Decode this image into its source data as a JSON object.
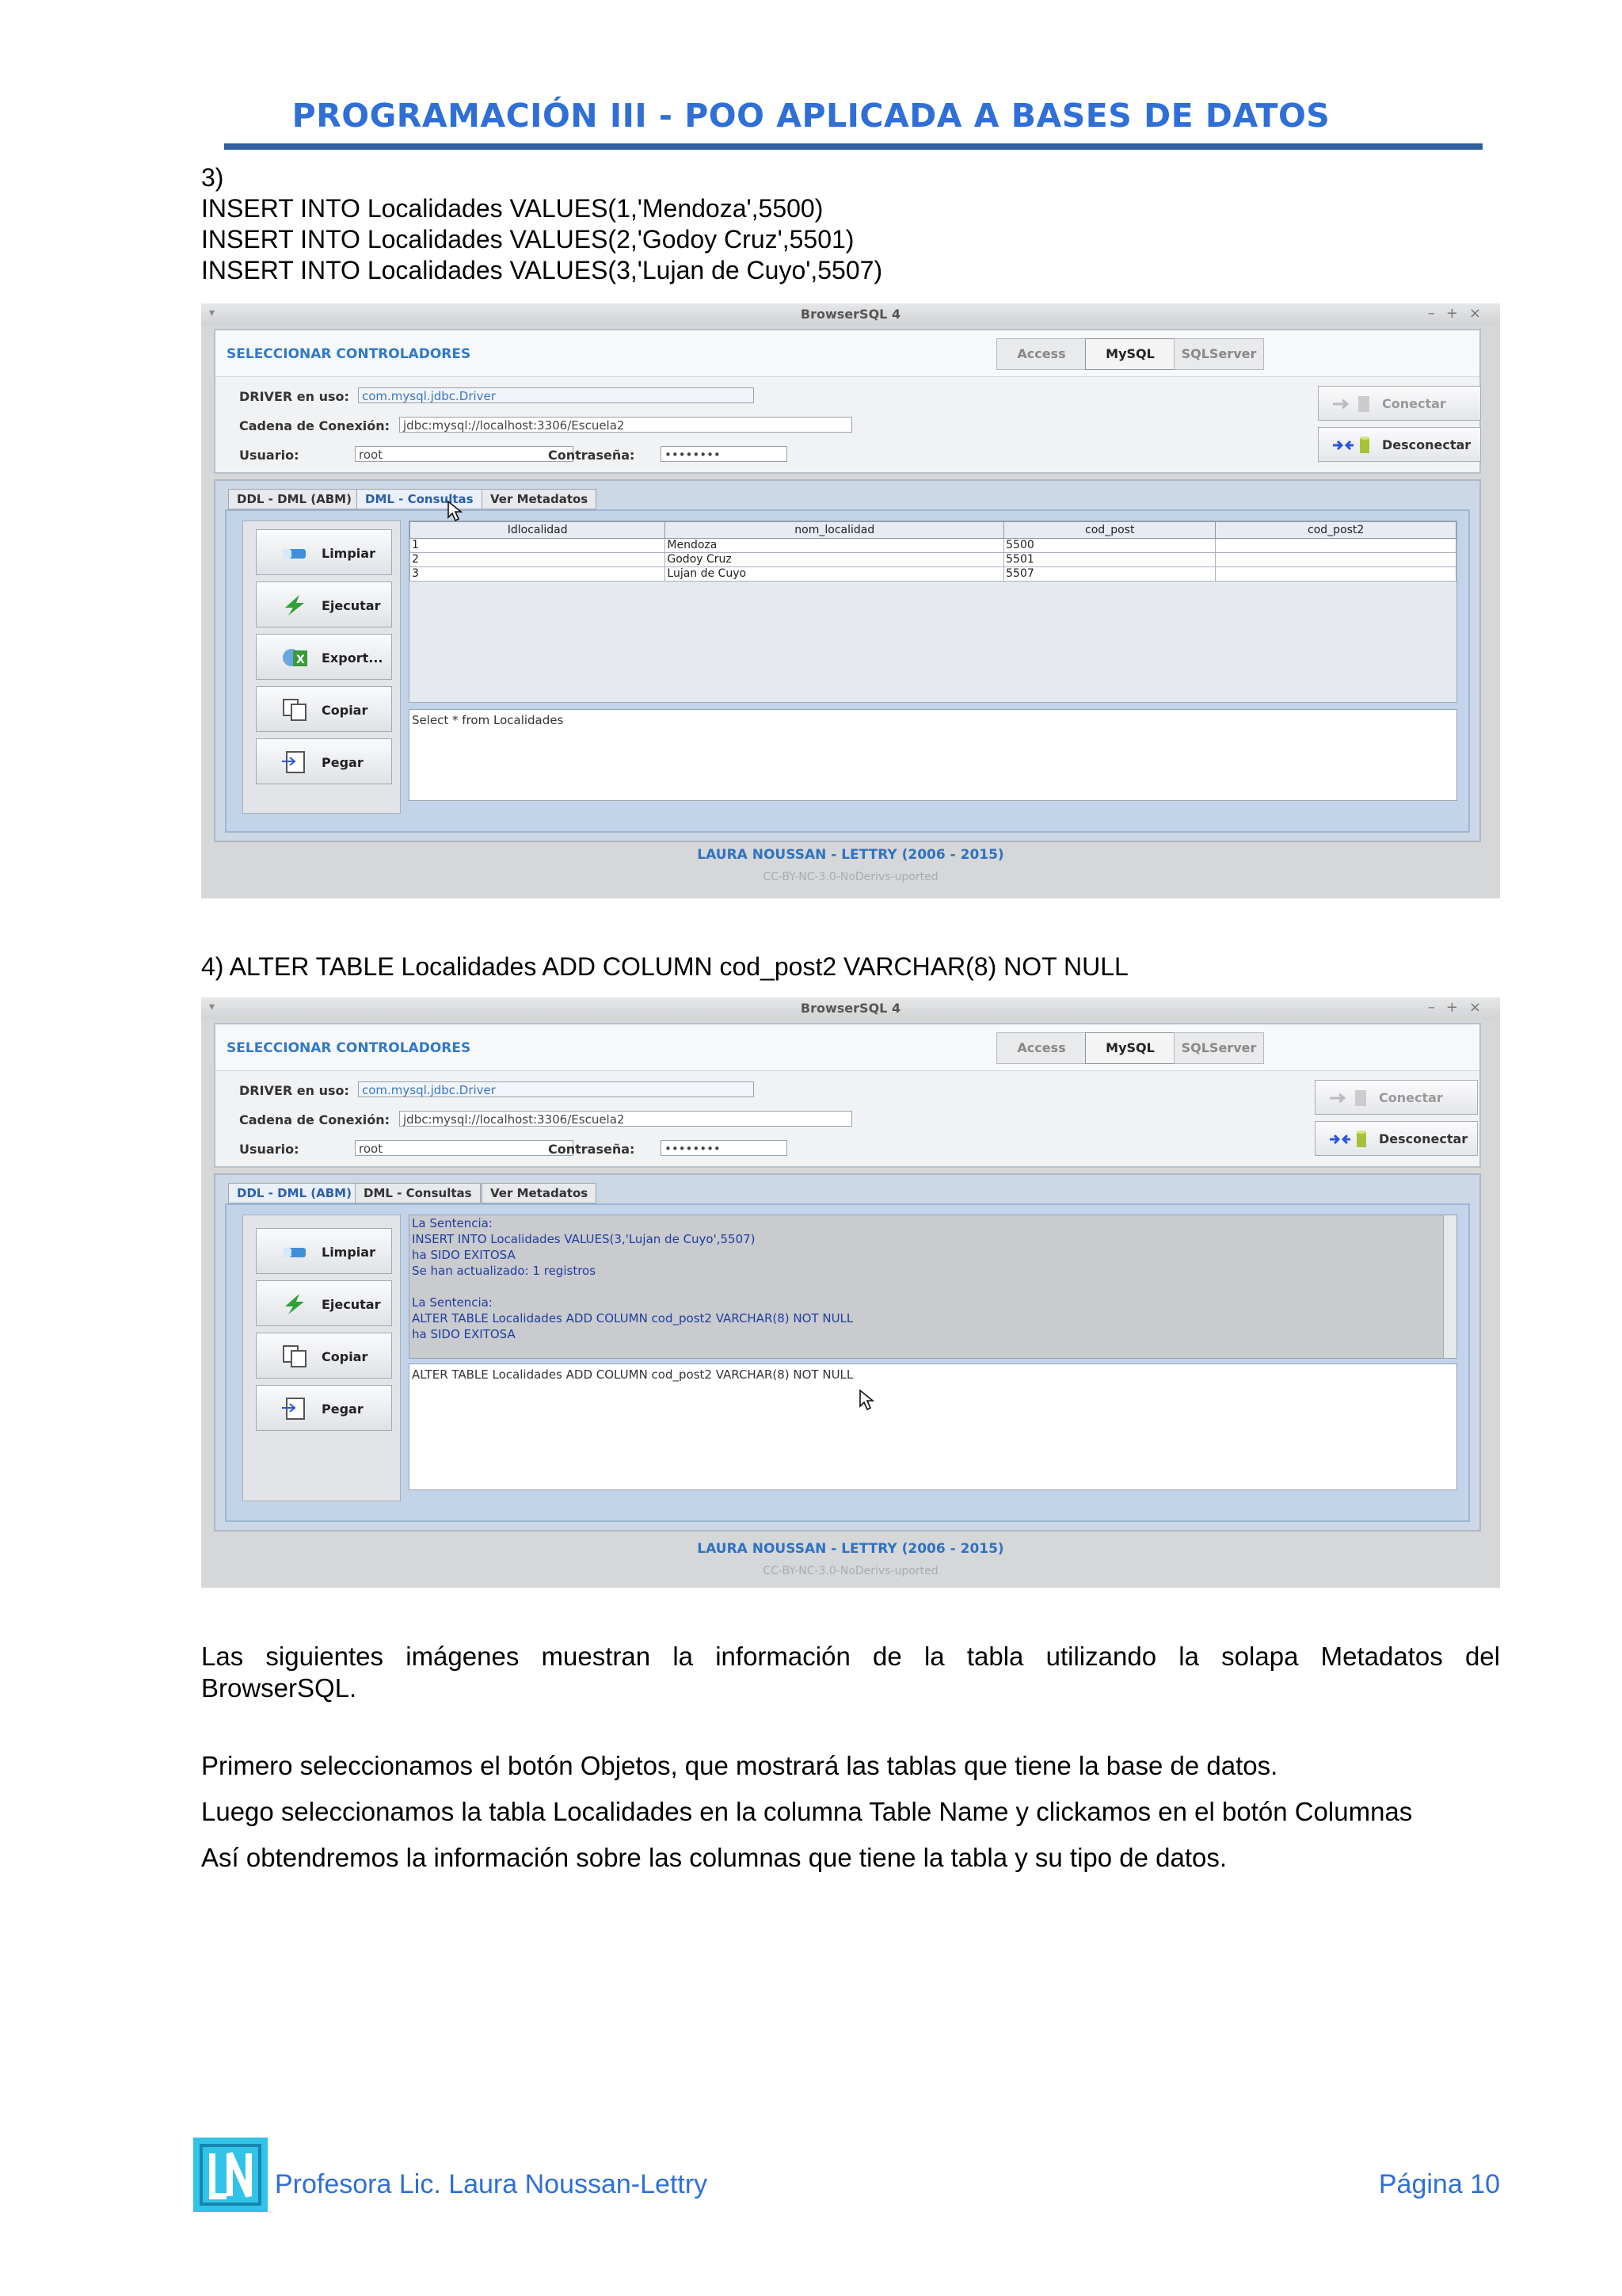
{
  "header": {
    "title": "PROGRAMACIÓN III - POO APLICADA A BASES DE DATOS"
  },
  "section3": {
    "label": "3)",
    "lines": [
      "INSERT INTO Localidades VALUES(1,'Mendoza',5500)",
      "INSERT INTO Localidades VALUES(2,'Godoy Cruz',5501)",
      "INSERT INTO Localidades VALUES(3,'Lujan de Cuyo',5507)"
    ]
  },
  "section4": {
    "heading": "4) ALTER TABLE Localidades ADD COLUMN cod_post2 VARCHAR(8) NOT NULL"
  },
  "app": {
    "window_title": "BrowserSQL 4",
    "select_title": "SELECCIONAR CONTROLADORES",
    "db_tabs": [
      "Access",
      "MySQL",
      "SQLServer"
    ],
    "driver_label": "DRIVER en uso:",
    "driver_value": "com.mysql.jdbc.Driver",
    "conn_label": "Cadena de Conexión:",
    "conn_value": "jdbc:mysql://localhost:3306/Escuela2",
    "user_label": "Usuario:",
    "user_value": "root",
    "pass_label": "Contraseña:",
    "pass_value": "••••••••",
    "connect_label": "Conectar",
    "disconnect_label": "Desconectar",
    "subtabs": [
      "DDL - DML (ABM)",
      "DML - Consultas",
      "Ver Metadatos"
    ],
    "btn_limpiar": "Limpiar",
    "btn_ejecutar": "Ejecutar",
    "btn_export": "Export...",
    "btn_copiar": "Copiar",
    "btn_pegar": "Pegar",
    "footer_credit": "LAURA NOUSSAN - LETTRY  (2006 - 2015)",
    "footer_license": "CC-BY-NC-3.0-NoDerivs-uported"
  },
  "shot1": {
    "columns": [
      "Idlocalidad",
      "nom_localidad",
      "cod_post",
      "cod_post2"
    ],
    "rows": [
      [
        "1",
        "Mendoza",
        "5500",
        ""
      ],
      [
        "2",
        "Godoy Cruz",
        "5501",
        ""
      ],
      [
        "3",
        "Lujan de Cuyo",
        "5507",
        ""
      ]
    ],
    "query": "Select * from Localidades"
  },
  "shot2": {
    "messages": [
      "La Sentencia:",
      "INSERT INTO Localidades VALUES(3,'Lujan de Cuyo',5507)",
      "ha SIDO EXITOSA",
      "Se han actualizado: 1 registros",
      "",
      "La Sentencia:",
      "ALTER TABLE Localidades ADD COLUMN cod_post2 VARCHAR(8) NOT NULL",
      "ha SIDO EXITOSA"
    ],
    "query": "ALTER TABLE Localidades ADD COLUMN cod_post2 VARCHAR(8) NOT NULL"
  },
  "body": {
    "p1": "Las siguientes imágenes muestran la información de la tabla utilizando la solapa Metadatos del",
    "p1b": "BrowserSQL.",
    "p2": "Primero seleccionamos el botón Objetos, que mostrará las tablas que tiene la base de datos.",
    "p3": "Luego seleccionamos la tabla Localidades en la columna Table Name y clickamos en el botón Columnas",
    "p4": "Así obtendremos la información sobre las columnas que tiene la tabla y su tipo de datos."
  },
  "footer": {
    "logo_text": "LN",
    "author": "Profesora Lic. Laura Noussan-Lettry",
    "page": "Página 10"
  },
  "colors": {
    "heading_blue": "#2f6fd6",
    "rule": "#2f5f9e",
    "logo": "#32c3e8"
  }
}
